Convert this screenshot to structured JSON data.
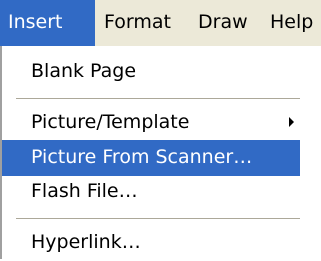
{
  "menubar": {
    "items": [
      {
        "label": "Insert",
        "active": true
      },
      {
        "label": "Format",
        "active": false
      },
      {
        "label": "Draw",
        "active": false
      },
      {
        "label": "Help",
        "active": false
      }
    ]
  },
  "insert_menu": {
    "items": [
      {
        "label": "Blank Page"
      },
      {
        "label": "Picture/Template",
        "submenu_icon": "chevron-right-icon"
      },
      {
        "label": "Picture From Scanner…",
        "highlighted": true
      },
      {
        "label": "Flash File…"
      },
      {
        "label": "Hyperlink…"
      }
    ]
  },
  "colors": {
    "menubar_bg": "#ece9d8",
    "highlight": "#316ac5",
    "highlight_text": "#ffffff",
    "menu_bg": "#ffffff",
    "separator": "#aca899"
  }
}
